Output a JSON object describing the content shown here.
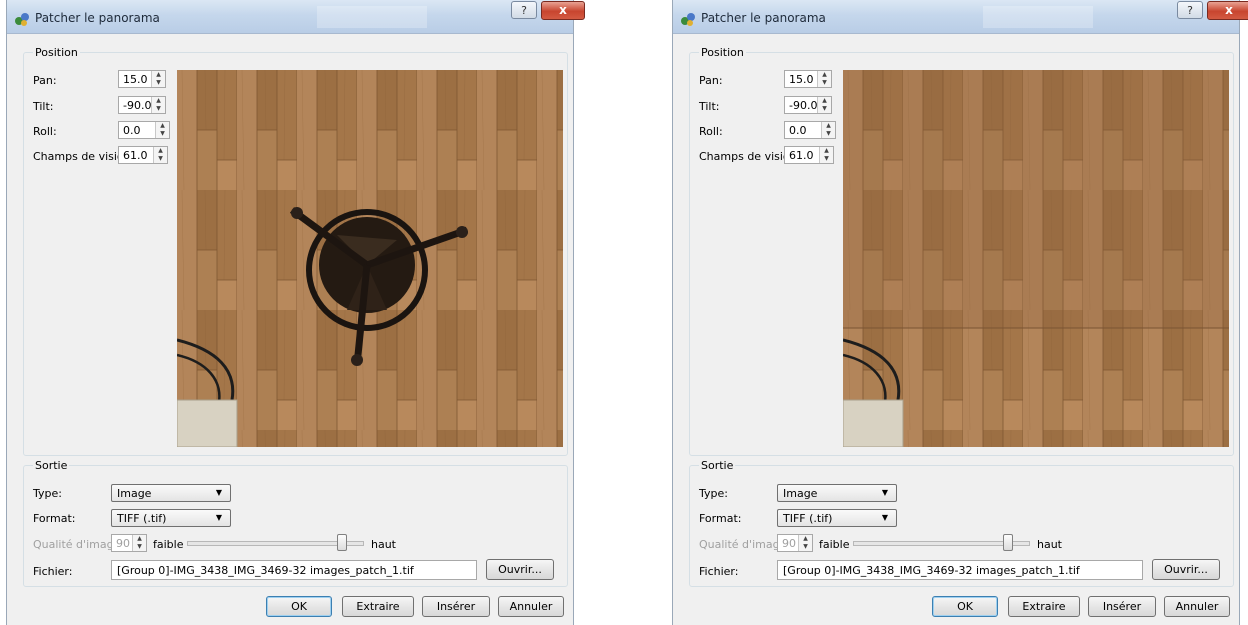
{
  "dialogs": [
    {
      "title": "Patcher le panorama",
      "help": "?",
      "close": "x",
      "position_group": "Position",
      "fields": [
        {
          "label": "Pan:",
          "value": "15.0"
        },
        {
          "label": "Tilt:",
          "value": "-90.0"
        },
        {
          "label": "Roll:",
          "value": "0.0"
        },
        {
          "label": "Champs de vision:",
          "value": "61.0"
        }
      ],
      "preview": {
        "description_icon": "tripod-nadir-image"
      },
      "output_group": "Sortie",
      "type_label": "Type:",
      "type_value": "Image",
      "format_label": "Format:",
      "format_value": "TIFF (.tif)",
      "quality_label": "Qualité d'image:",
      "quality_value": "90",
      "quality_low": "faible",
      "quality_high": "haut",
      "quality_level": 0.9,
      "file_label": "Fichier:",
      "file_value": "[Group 0]-IMG_3438_IMG_3469-32 images_patch_1.tif",
      "open_button": "Ouvrir...",
      "buttons": {
        "ok": "OK",
        "extract": "Extraire",
        "insert": "Insérer",
        "cancel": "Annuler"
      }
    },
    {
      "title": "Patcher le panorama",
      "help": "?",
      "close": "x",
      "position_group": "Position",
      "fields": [
        {
          "label": "Pan:",
          "value": "15.0"
        },
        {
          "label": "Tilt:",
          "value": "-90.0"
        },
        {
          "label": "Roll:",
          "value": "0.0"
        },
        {
          "label": "Champs de vision:",
          "value": "61.0"
        }
      ],
      "preview": {
        "description_icon": "patched-floor-image"
      },
      "output_group": "Sortie",
      "type_label": "Type:",
      "type_value": "Image",
      "format_label": "Format:",
      "format_value": "TIFF (.tif)",
      "quality_label": "Qualité d'image:",
      "quality_value": "90",
      "quality_low": "faible",
      "quality_high": "haut",
      "quality_level": 0.9,
      "file_label": "Fichier:",
      "file_value": "[Group 0]-IMG_3438_IMG_3469-32 images_patch_1.tif",
      "open_button": "Ouvrir...",
      "buttons": {
        "ok": "OK",
        "extract": "Extraire",
        "insert": "Insérer",
        "cancel": "Annuler"
      }
    }
  ],
  "colors": {
    "accent": "#3c7fb1",
    "close_red": "#c8452f",
    "floor": "#a77a4c"
  }
}
